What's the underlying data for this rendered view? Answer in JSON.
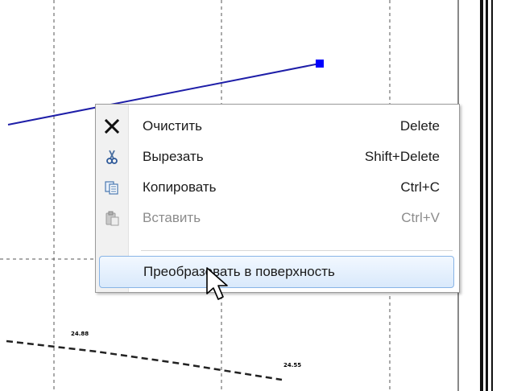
{
  "canvas": {
    "line_color": "#1e1ea8",
    "handle_color": "#0000ff",
    "grid_color": "#555555",
    "labels": [
      "24.88",
      "24.55"
    ]
  },
  "context_menu": {
    "items": [
      {
        "icon": "close-x-icon",
        "label": "Очистить",
        "shortcut": "Delete",
        "enabled": true
      },
      {
        "icon": "scissors-icon",
        "label": "Вырезать",
        "shortcut": "Shift+Delete",
        "enabled": true
      },
      {
        "icon": "copy-icon",
        "label": "Копировать",
        "shortcut": "Ctrl+C",
        "enabled": true
      },
      {
        "icon": "paste-icon",
        "label": "Вставить",
        "shortcut": "Ctrl+V",
        "enabled": false
      }
    ],
    "highlighted_item": {
      "label": "Преобразовать в поверхность"
    },
    "highlight_color": "#d9e9fb"
  }
}
